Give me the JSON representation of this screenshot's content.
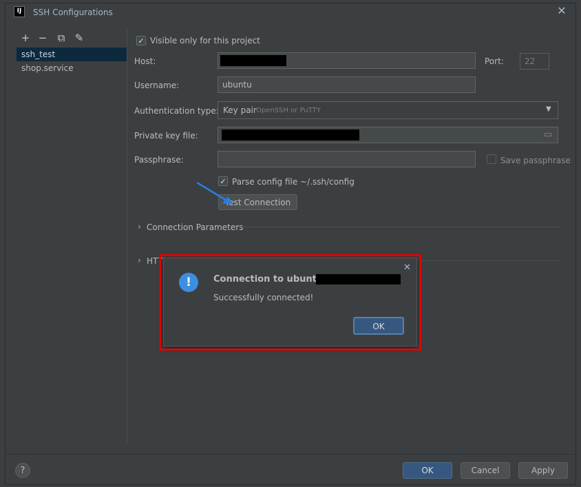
{
  "window": {
    "title": "SSH Configurations",
    "app_icon": "IJ"
  },
  "toolbar": {
    "add_icon": "+",
    "remove_icon": "−",
    "copy_icon": "⧉",
    "edit_icon": "✎"
  },
  "configs": [
    "ssh_test",
    "shop.service"
  ],
  "form": {
    "visible_only_label": "Visible only for this project",
    "visible_only_checked": "✓",
    "host_label": "Host:",
    "port_label": "Port:",
    "port_placeholder": "22",
    "username_label": "Username:",
    "username_value": "ubuntu",
    "auth_type_label": "Authentication type:",
    "auth_type_value": "Key pair",
    "auth_type_hint": "OpenSSH or PuTTY",
    "private_key_label": "Private key file:",
    "passphrase_label": "Passphrase:",
    "save_passphrase_label": "Save passphrase",
    "parse_config_label": "Parse config file ~/.ssh/config",
    "parse_config_checked": "✓",
    "test_connection_label": "Test Connection"
  },
  "sections": {
    "connection_params": "Connection Parameters",
    "http_proxy": "HTTP"
  },
  "popup": {
    "title": "Connection to ubuntu@",
    "message": "Successfully connected!",
    "ok_label": "OK",
    "close_icon": "✕",
    "info_icon": "!"
  },
  "footer": {
    "help_label": "?",
    "ok_label": "OK",
    "cancel_label": "Cancel",
    "apply_label": "Apply"
  },
  "colors": {
    "accent": "#365880",
    "highlight": "#e00000",
    "arrow": "#2a7de1"
  }
}
